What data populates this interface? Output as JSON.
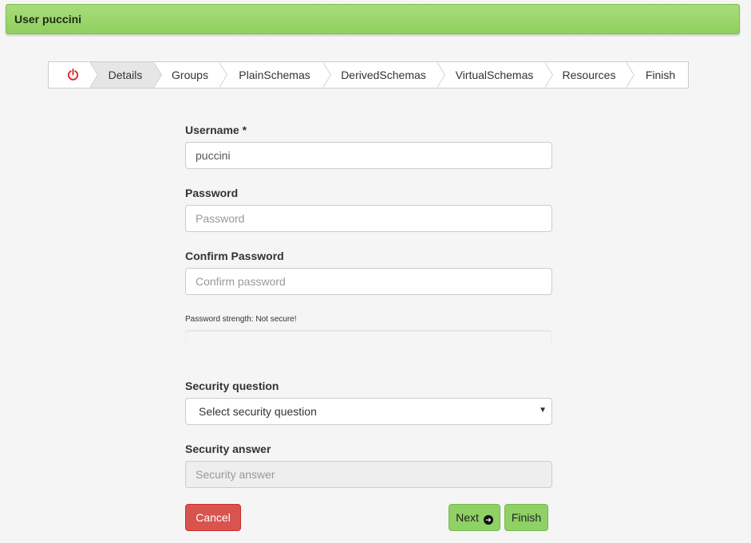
{
  "header": {
    "title": "User puccini"
  },
  "wizard": {
    "steps": [
      {
        "label": "Details"
      },
      {
        "label": "Groups"
      },
      {
        "label": "PlainSchemas"
      },
      {
        "label": "DerivedSchemas"
      },
      {
        "label": "VirtualSchemas"
      },
      {
        "label": "Resources"
      },
      {
        "label": "Finish"
      }
    ],
    "active_step": "Details",
    "power_icon": "power-icon",
    "power_color": "#e02020"
  },
  "form": {
    "username": {
      "label": "Username *",
      "value": "puccini"
    },
    "password": {
      "label": "Password",
      "placeholder": "Password"
    },
    "confirm_password": {
      "label": "Confirm Password",
      "placeholder": "Confirm password"
    },
    "password_strength": "Password strength: Not secure!",
    "security_question": {
      "label": "Security question",
      "selected": "Select security question"
    },
    "security_answer": {
      "label": "Security answer",
      "placeholder": "Security answer"
    }
  },
  "buttons": {
    "cancel": "Cancel",
    "next": "Next",
    "finish": "Finish"
  },
  "colors": {
    "header_green": "#96d468",
    "cancel_red": "#d9534f",
    "action_green": "#8fd165"
  }
}
